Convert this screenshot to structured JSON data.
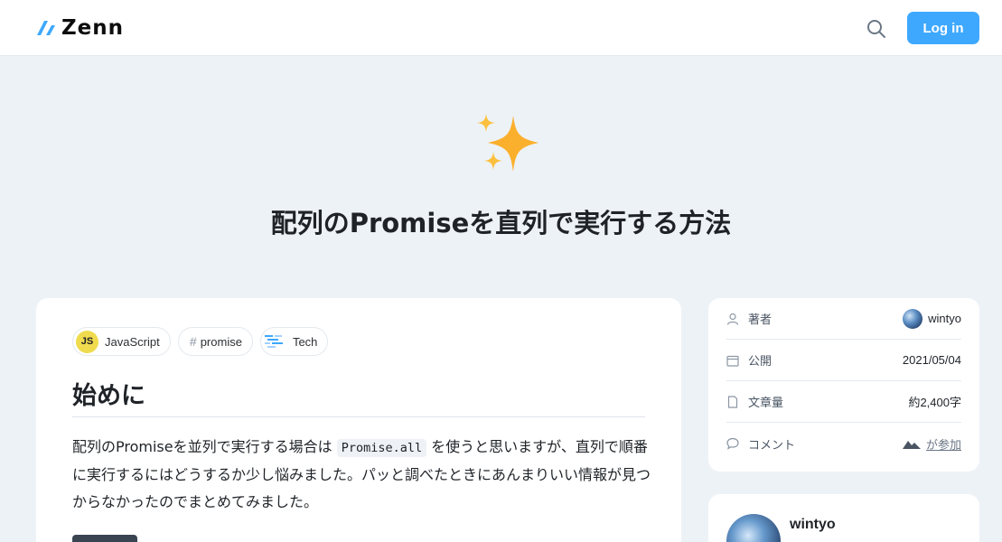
{
  "header": {
    "logo_text": "Zenn",
    "login_label": "Log in"
  },
  "hero": {
    "emoji": "sparkles-icon",
    "title": "配列のPromiseを直列で実行する方法"
  },
  "topics": [
    {
      "label": "JavaScript",
      "icon": "JS"
    },
    {
      "label": "promise",
      "icon": "#"
    },
    {
      "label": "Tech",
      "icon": "tech-icon"
    }
  ],
  "article": {
    "heading": "始めに",
    "para_part1": "配列のPromiseを並列で実行する場合は ",
    "code": "Promise.all",
    "para_part2": " を使うと思いますが、直列で順番に実行するにはどうするか少し悩みました。パッと調べたときにあんまりいい情報が見つからなかったのでまとめてみました。"
  },
  "info": {
    "author_label": "著者",
    "author_value": "wintyo",
    "published_label": "公開",
    "published_value": "2021/05/04",
    "length_label": "文章量",
    "length_value": "約2,400字",
    "comment_label": "コメント",
    "comment_value": "が参加"
  },
  "author_card": {
    "name": "wintyo"
  },
  "colors": {
    "accent": "#3ea8ff",
    "background": "#edf2f7"
  }
}
